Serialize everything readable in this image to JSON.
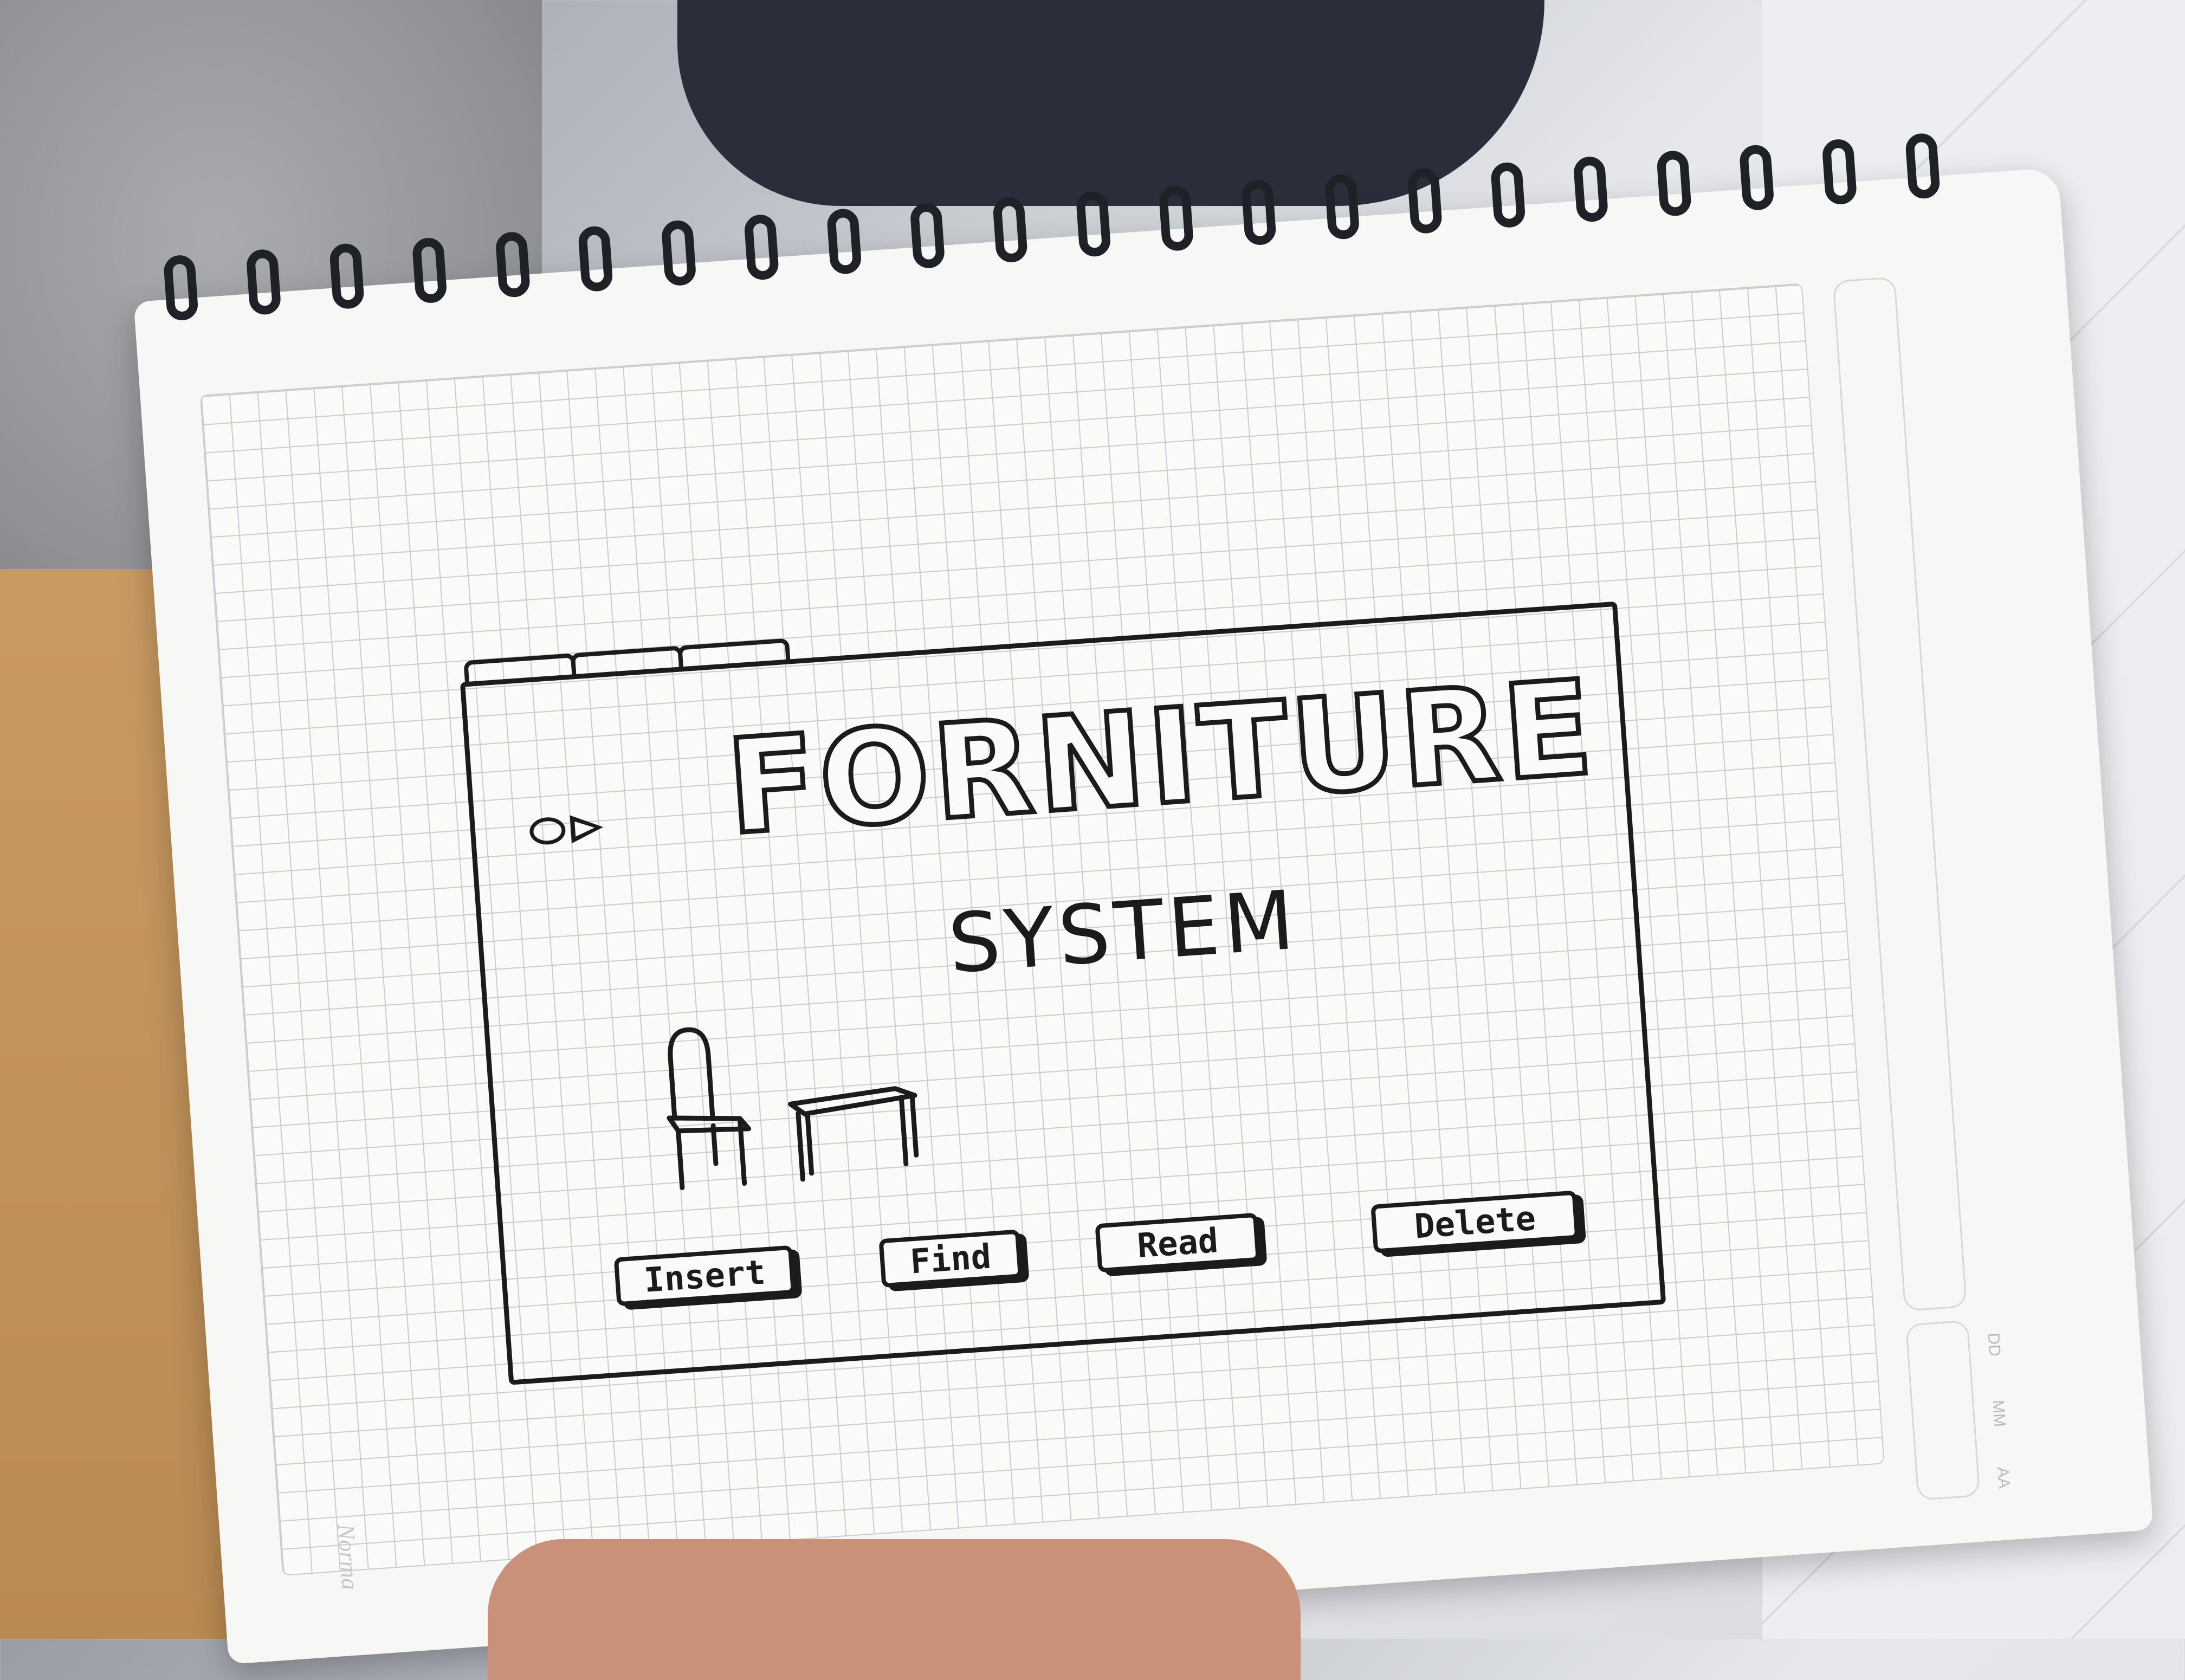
{
  "sketch": {
    "title": "FORNITURE",
    "subtitle": "SYSTEM",
    "buttons": {
      "insert": "Insert",
      "find": "Find",
      "read": "Read",
      "delete": "Delete"
    },
    "illustration_icons": [
      "chair-icon",
      "table-icon"
    ]
  },
  "notebook": {
    "brand": "Norma",
    "date_labels": [
      "DD",
      "MM",
      "AA"
    ]
  },
  "colors": {
    "ink": "#1b1b1b",
    "paper": "#fafaf9",
    "grid": "#c9ccd0"
  }
}
